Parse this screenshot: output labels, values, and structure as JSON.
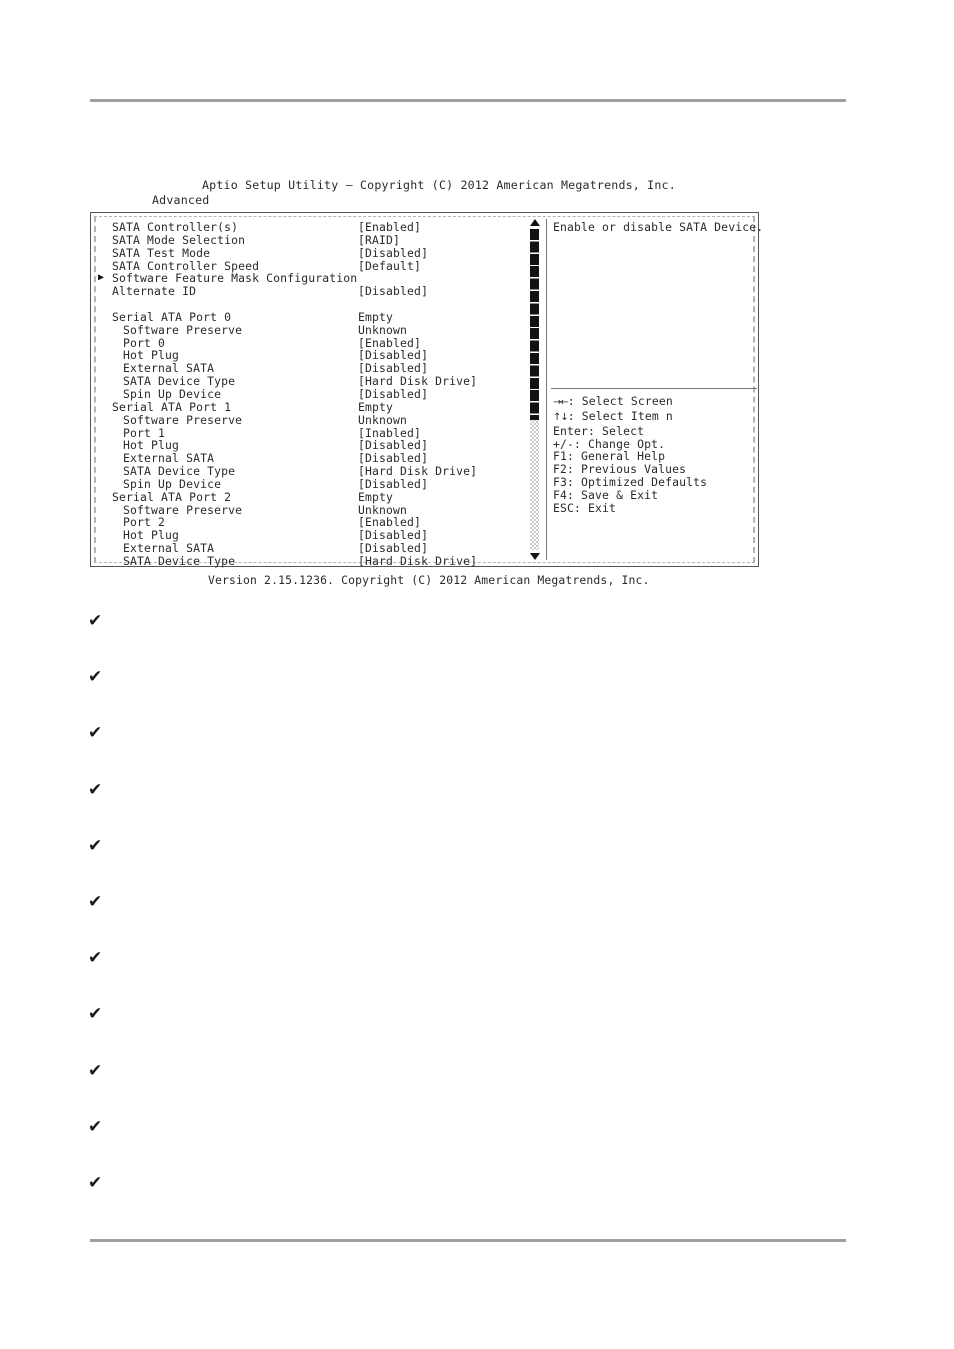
{
  "page": {
    "rule_top": "",
    "rule_bottom": ""
  },
  "bios": {
    "title": "Aptio Setup Utility – Copyright (C) 2012 American Megatrends, Inc.",
    "tab": "Advanced",
    "version": "Version 2.15.1236. Copyright (C) 2012 American Megatrends, Inc.",
    "scrollbar": {
      "up_arrow": "▲",
      "down_arrow": "▼"
    },
    "options": [
      {
        "arrow": "",
        "label": "SATA Controller(s)",
        "indent": 0,
        "value": "[Enabled]"
      },
      {
        "arrow": "",
        "label": "SATA Mode Selection",
        "indent": 0,
        "value": "[RAID]"
      },
      {
        "arrow": "",
        "label": "SATA Test Mode",
        "indent": 0,
        "value": "[Disabled]"
      },
      {
        "arrow": "",
        "label": "SATA Controller Speed",
        "indent": 0,
        "value": "[Default]"
      },
      {
        "arrow": "▶",
        "label": "Software Feature Mask Configuration",
        "indent": 0,
        "value": ""
      },
      {
        "arrow": "",
        "label": "Alternate ID",
        "indent": 0,
        "value": "[Disabled]"
      },
      {
        "arrow": "",
        "label": "",
        "indent": 0,
        "value": ""
      },
      {
        "arrow": "",
        "label": "Serial ATA Port 0",
        "indent": 0,
        "value": "Empty"
      },
      {
        "arrow": "",
        "label": "Software Preserve",
        "indent": 1,
        "value": "Unknown"
      },
      {
        "arrow": "",
        "label": "Port 0",
        "indent": 1,
        "value": "[Enabled]"
      },
      {
        "arrow": "",
        "label": "Hot Plug",
        "indent": 1,
        "value": "[Disabled]"
      },
      {
        "arrow": "",
        "label": "External SATA",
        "indent": 1,
        "value": "[Disabled]"
      },
      {
        "arrow": "",
        "label": "SATA Device Type",
        "indent": 1,
        "value": "[Hard Disk Drive]"
      },
      {
        "arrow": "",
        "label": "Spin Up Device",
        "indent": 1,
        "value": "[Disabled]"
      },
      {
        "arrow": "",
        "label": "Serial ATA Port 1",
        "indent": 0,
        "value": "Empty"
      },
      {
        "arrow": "",
        "label": "Software Preserve",
        "indent": 1,
        "value": "Unknown"
      },
      {
        "arrow": "",
        "label": "Port 1",
        "indent": 1,
        "value": "[Inabled]"
      },
      {
        "arrow": "",
        "label": "Hot Plug",
        "indent": 1,
        "value": "[Disabled]"
      },
      {
        "arrow": "",
        "label": "External SATA",
        "indent": 1,
        "value": "[Disabled]"
      },
      {
        "arrow": "",
        "label": "SATA Device Type",
        "indent": 1,
        "value": "[Hard Disk Drive]"
      },
      {
        "arrow": "",
        "label": "Spin Up Device",
        "indent": 1,
        "value": "[Disabled]"
      },
      {
        "arrow": "",
        "label": "Serial ATA Port 2",
        "indent": 0,
        "value": "Empty"
      },
      {
        "arrow": "",
        "label": "Software Preserve",
        "indent": 1,
        "value": "Unknown"
      },
      {
        "arrow": "",
        "label": "Port 2",
        "indent": 1,
        "value": "[Enabled]"
      },
      {
        "arrow": "",
        "label": "Hot Plug",
        "indent": 1,
        "value": "[Disabled]"
      },
      {
        "arrow": "",
        "label": "External SATA",
        "indent": 1,
        "value": "[Disabled]"
      },
      {
        "arrow": "",
        "label": "SATA Device Type",
        "indent": 1,
        "value": "[Hard Disk Drive]"
      }
    ],
    "help": {
      "text": "Enable or disable SATA Device."
    },
    "keys": [
      {
        "glyph": "→←",
        "text": ": Select Screen"
      },
      {
        "glyph": "↑↓",
        "text": ": Select Item n"
      },
      {
        "glyph": "",
        "text": "Enter: Select"
      },
      {
        "glyph": "",
        "text": "+/-: Change Opt."
      },
      {
        "glyph": "",
        "text": "F1: General Help"
      },
      {
        "glyph": "",
        "text": "F2: Previous Values"
      },
      {
        "glyph": "",
        "text": "F3: Optimized Defaults"
      },
      {
        "glyph": "",
        "text": "F4: Save & Exit"
      },
      {
        "glyph": "",
        "text": "ESC: Exit"
      }
    ]
  },
  "checklist": {
    "marker": "✔",
    "items": [
      "",
      "",
      "",
      "",
      "",
      "",
      "",
      "",
      "",
      "",
      ""
    ]
  }
}
